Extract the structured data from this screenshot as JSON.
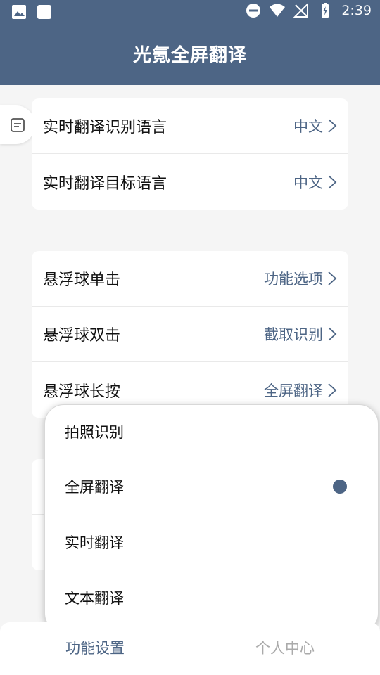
{
  "status_bar": {
    "time": "2:39"
  },
  "app_bar": {
    "title": "光氪全屏翻译"
  },
  "realtime_section": {
    "items": [
      {
        "label": "实时翻译识别语言",
        "value": "中文"
      },
      {
        "label": "实时翻译目标语言",
        "value": "中文"
      }
    ]
  },
  "floating_ball_section": {
    "items": [
      {
        "label": "悬浮球单击",
        "value": "功能选项"
      },
      {
        "label": "悬浮球双击",
        "value": "截取识别"
      },
      {
        "label": "悬浮球长按",
        "value": "全屏翻译"
      }
    ]
  },
  "popup_menu": {
    "options": [
      {
        "label": "拍照识别"
      },
      {
        "label": "全屏翻译",
        "selected": true
      },
      {
        "label": "实时翻译"
      },
      {
        "label": "文本翻译"
      }
    ]
  },
  "bottom_nav": {
    "items": [
      {
        "label": "功能设置",
        "active": true
      },
      {
        "label": "个人中心",
        "active": false
      }
    ]
  },
  "colors": {
    "primary": "#4d6585",
    "background": "#f5f5f5"
  }
}
